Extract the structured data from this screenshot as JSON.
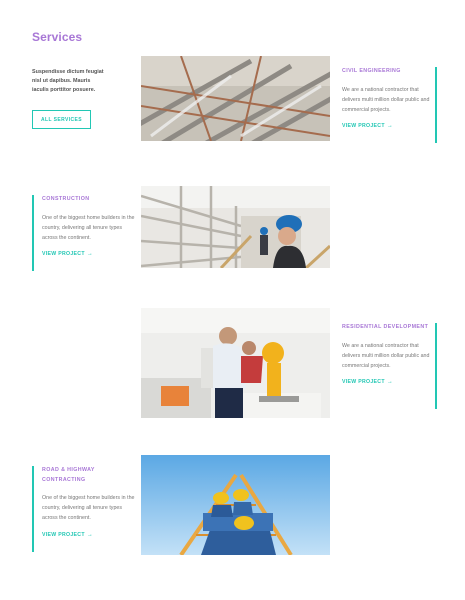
{
  "page": {
    "title": "Services"
  },
  "intro": {
    "text": "Suspendisse dictum feugiat nisl ut dapibus. Mauris iaculis porttitor posuere."
  },
  "all_services_button": {
    "label": "ALL SERVICES"
  },
  "projects": [
    {
      "category": "CIVIL ENGINEERING",
      "description": "We are a national contractor that delivers multi million dollar public and commercial projects.",
      "link": "VIEW PROJECT",
      "image": "steel-structure-construction-photo"
    },
    {
      "category": "CONSTRUCTION",
      "description": "One of the biggest home builders in the country, delivering all tenure types across the continent.",
      "link": "VIEW PROJECT",
      "image": "woman-in-blue-hard-hat-on-bridge-photo"
    },
    {
      "category": "RESIDENTIAL DEVELOPMENT",
      "description": "We are a national contractor that delivers multi million dollar public and commercial projects.",
      "link": "VIEW PROJECT",
      "image": "workers-with-circular-saw-photo"
    },
    {
      "category": "ROAD & HIGHWAY CONTRACTING",
      "description": "One of the biggest home builders in the country, delivering all tenure types across the continent.",
      "link": "VIEW PROJECT",
      "image": "workers-in-hard-hats-on-ladder-photo"
    }
  ],
  "icons": {
    "arrow": "arrow-right-icon"
  },
  "colors": {
    "accent": "#22c7b4",
    "heading": "#a877d6"
  }
}
